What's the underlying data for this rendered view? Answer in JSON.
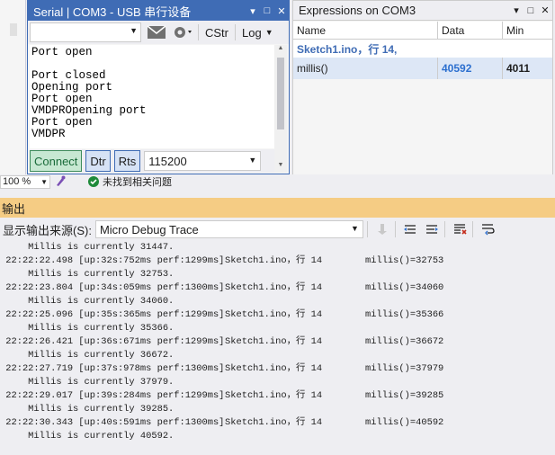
{
  "serial": {
    "title": "Serial | COM3   - USB 串行设备",
    "toolbar": {
      "cstr_label": "CStr",
      "log_label": "Log"
    },
    "lines": [
      "Port open",
      "",
      "Port closed",
      "Opening port",
      "Port open",
      "VMDPROpening port",
      "Port open",
      "VMDPR"
    ],
    "bottom": {
      "connect_label": "Connect",
      "dtr_label": "Dtr",
      "rts_label": "Rts",
      "baud_value": "115200"
    }
  },
  "expressions": {
    "title": "Expressions on COM3",
    "columns": [
      "Name",
      "Data",
      "Min"
    ],
    "file_row": "Sketch1.ino，行 14,",
    "rows": [
      {
        "name": "millis()",
        "data": "40592",
        "min": "4011"
      }
    ]
  },
  "status": {
    "zoom": "100 %",
    "issues_text": "未找到相关问题"
  },
  "output": {
    "title": "输出",
    "source_label": "显示输出来源(S):",
    "source_value": "Micro Debug Trace",
    "lines": [
      {
        "type": "msg",
        "text": "     Millis is currently 31447."
      },
      {
        "type": "trace",
        "time": "22:22:22.498 [up:32s:752ms perf:1299ms]",
        "file": "Sketch1.ino，行 14",
        "expr": "millis()=32753"
      },
      {
        "type": "msg",
        "text": "     Millis is currently 32753."
      },
      {
        "type": "trace",
        "time": "22:22:23.804 [up:34s:059ms perf:1300ms]",
        "file": "Sketch1.ino，行 14",
        "expr": "millis()=34060"
      },
      {
        "type": "msg",
        "text": "     Millis is currently 34060."
      },
      {
        "type": "trace",
        "time": "22:22:25.096 [up:35s:365ms perf:1299ms]",
        "file": "Sketch1.ino，行 14",
        "expr": "millis()=35366"
      },
      {
        "type": "msg",
        "text": "     Millis is currently 35366."
      },
      {
        "type": "trace",
        "time": "22:22:26.421 [up:36s:671ms perf:1299ms]",
        "file": "Sketch1.ino，行 14",
        "expr": "millis()=36672"
      },
      {
        "type": "msg",
        "text": "     Millis is currently 36672."
      },
      {
        "type": "trace",
        "time": "22:22:27.719 [up:37s:978ms perf:1300ms]",
        "file": "Sketch1.ino，行 14",
        "expr": "millis()=37979"
      },
      {
        "type": "msg",
        "text": "     Millis is currently 37979."
      },
      {
        "type": "trace",
        "time": "22:22:29.017 [up:39s:284ms perf:1299ms]",
        "file": "Sketch1.ino，行 14",
        "expr": "millis()=39285"
      },
      {
        "type": "msg",
        "text": "     Millis is currently 39285."
      },
      {
        "type": "trace",
        "time": "22:22:30.343 [up:40s:591ms perf:1300ms]",
        "file": "Sketch1.ino，行 14",
        "expr": "millis()=40592"
      },
      {
        "type": "msg",
        "text": "     Millis is currently 40592."
      }
    ]
  },
  "colors": {
    "accent": "#3f6cb5",
    "output_title_bg": "#f5cc84",
    "connect_green": "#1a6b3a",
    "value_blue": "#2c6fcf"
  }
}
